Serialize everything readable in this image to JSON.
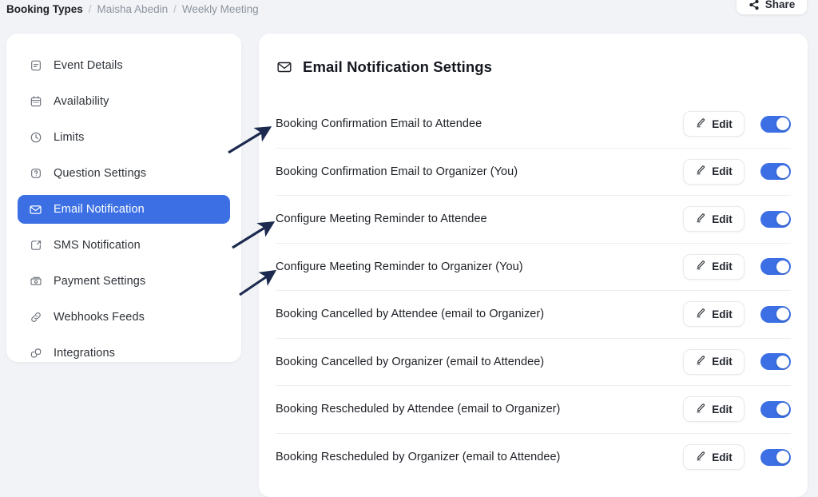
{
  "breadcrumb": {
    "items": [
      {
        "label": "Booking Types",
        "current": true
      },
      {
        "label": "Maisha Abedin",
        "current": false
      },
      {
        "label": "Weekly Meeting",
        "current": false
      }
    ],
    "separator": "/"
  },
  "topbar": {
    "share_label": "Share",
    "share_icon": "share-nodes-icon"
  },
  "sidebar": {
    "items": [
      {
        "label": "Event Details",
        "icon": "event-details-icon",
        "active": false
      },
      {
        "label": "Availability",
        "icon": "calendar-icon",
        "active": false
      },
      {
        "label": "Limits",
        "icon": "clock-icon",
        "active": false
      },
      {
        "label": "Question Settings",
        "icon": "question-circle-icon",
        "active": false
      },
      {
        "label": "Email Notification",
        "icon": "envelope-icon",
        "active": true
      },
      {
        "label": "SMS Notification",
        "icon": "sms-icon",
        "active": false
      },
      {
        "label": "Payment Settings",
        "icon": "payment-card-icon",
        "active": false
      },
      {
        "label": "Webhooks Feeds",
        "icon": "link-icon",
        "active": false
      },
      {
        "label": "Integrations",
        "icon": "integrations-icon",
        "active": false
      }
    ]
  },
  "panel": {
    "title": "Email Notification Settings",
    "title_icon": "envelope-icon",
    "edit_label": "Edit",
    "edit_icon": "pencil-icon",
    "rows": [
      {
        "label": "Booking Confirmation Email to Attendee",
        "enabled": true,
        "annotated": true
      },
      {
        "label": "Booking Confirmation Email to Organizer (You)",
        "enabled": true,
        "annotated": false
      },
      {
        "label": "Configure Meeting Reminder to Attendee",
        "enabled": true,
        "annotated": true
      },
      {
        "label": "Configure Meeting Reminder to Organizer (You)",
        "enabled": true,
        "annotated": true
      },
      {
        "label": "Booking Cancelled by Attendee (email to Organizer)",
        "enabled": true,
        "annotated": false
      },
      {
        "label": "Booking Cancelled by Organizer (email to Attendee)",
        "enabled": true,
        "annotated": false
      },
      {
        "label": "Booking Rescheduled by Attendee (email to Organizer)",
        "enabled": true,
        "annotated": false
      },
      {
        "label": "Booking Rescheduled by Organizer (email to Attendee)",
        "enabled": true,
        "annotated": false
      }
    ]
  },
  "colors": {
    "accent_blue": "#3b6fe3",
    "page_background": "#f1f3f6",
    "card_background": "#ffffff",
    "annotation_arrow": "#1b2a4e",
    "divider": "#eceef1"
  }
}
